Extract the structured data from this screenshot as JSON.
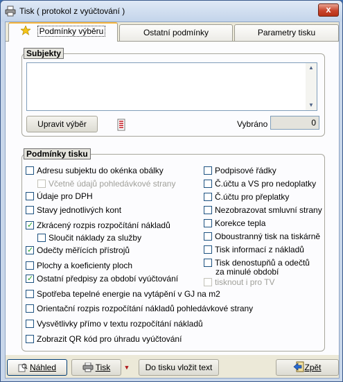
{
  "window": {
    "title": "Tisk ( protokol z vyúčtování )",
    "close_label": "x"
  },
  "tabs": [
    {
      "label": "Podmínky výběru",
      "active": true
    },
    {
      "label": "Ostatní podmínky",
      "active": false
    },
    {
      "label": "Parametry tisku",
      "active": false
    }
  ],
  "subjekty": {
    "title": "Subjekty",
    "edit_button": "Upravit výběr",
    "selected_label": "Vybráno",
    "selected_value": "0"
  },
  "podminky": {
    "title": "Podmínky tisku",
    "left": [
      {
        "label": "Adresu subjektu do okénka obálky",
        "checked": false,
        "enabled": true
      },
      {
        "label": "Včetně údajů pohledávkové strany",
        "checked": false,
        "enabled": false
      },
      {
        "label": "Údaje pro DPH",
        "checked": false,
        "enabled": true
      },
      {
        "label": "Stavy jednotlivých kont",
        "checked": false,
        "enabled": true
      },
      {
        "label": "Zkrácený rozpis rozpočítání nákladů",
        "checked": true,
        "enabled": true
      },
      {
        "label": "Sloučit náklady za služby",
        "checked": false,
        "enabled": true
      },
      {
        "label": "Odečty měřících přístrojů",
        "checked": true,
        "enabled": true
      },
      {
        "label": "Plochy a koeficienty ploch",
        "checked": false,
        "enabled": true
      },
      {
        "label": "Ostatní předpisy za období vyúčtování",
        "checked": true,
        "enabled": true
      },
      {
        "label": "Spotřeba tepelné energie na vytápění v GJ na m2",
        "checked": false,
        "enabled": true
      },
      {
        "label": "Orientační rozpis rozpočítání nákladů pohledávkové strany",
        "checked": false,
        "enabled": true
      },
      {
        "label": "Vysvětlivky přímo v textu rozpočítání nákladů",
        "checked": false,
        "enabled": true
      },
      {
        "label": "Zobrazit QR kód pro úhradu vyúčtování",
        "checked": false,
        "enabled": true
      }
    ],
    "right": [
      {
        "label": "Podpisové řádky",
        "checked": false,
        "enabled": true
      },
      {
        "label": "Č.účtu a VS pro nedoplatky",
        "checked": false,
        "enabled": true
      },
      {
        "label": "Č.účtu pro přeplatky",
        "checked": false,
        "enabled": true
      },
      {
        "label": "Nezobrazovat smluvní strany",
        "checked": false,
        "enabled": true
      },
      {
        "label": "Korekce tepla",
        "checked": false,
        "enabled": true
      },
      {
        "label": "Oboustranný tisk na tiskárně",
        "checked": false,
        "enabled": true
      },
      {
        "label": "Tisk informací z nákladů",
        "checked": false,
        "enabled": true
      },
      {
        "label": "Tisk denostupňů a odečtů",
        "label2": "za minulé období",
        "checked": false,
        "enabled": true
      },
      {
        "label": "tisknout i pro TV",
        "checked": false,
        "enabled": false
      }
    ]
  },
  "footer": {
    "preview_label": "Náhled",
    "print_label": "Tisk",
    "insert_text_label": "Do tisku vložit text",
    "back_label": "Zpět"
  },
  "icons": {
    "app": "printer-icon",
    "tab_star": "star-icon",
    "preview": "magnifier-icon",
    "print": "printer-icon",
    "back": "back-arrow-icon"
  }
}
